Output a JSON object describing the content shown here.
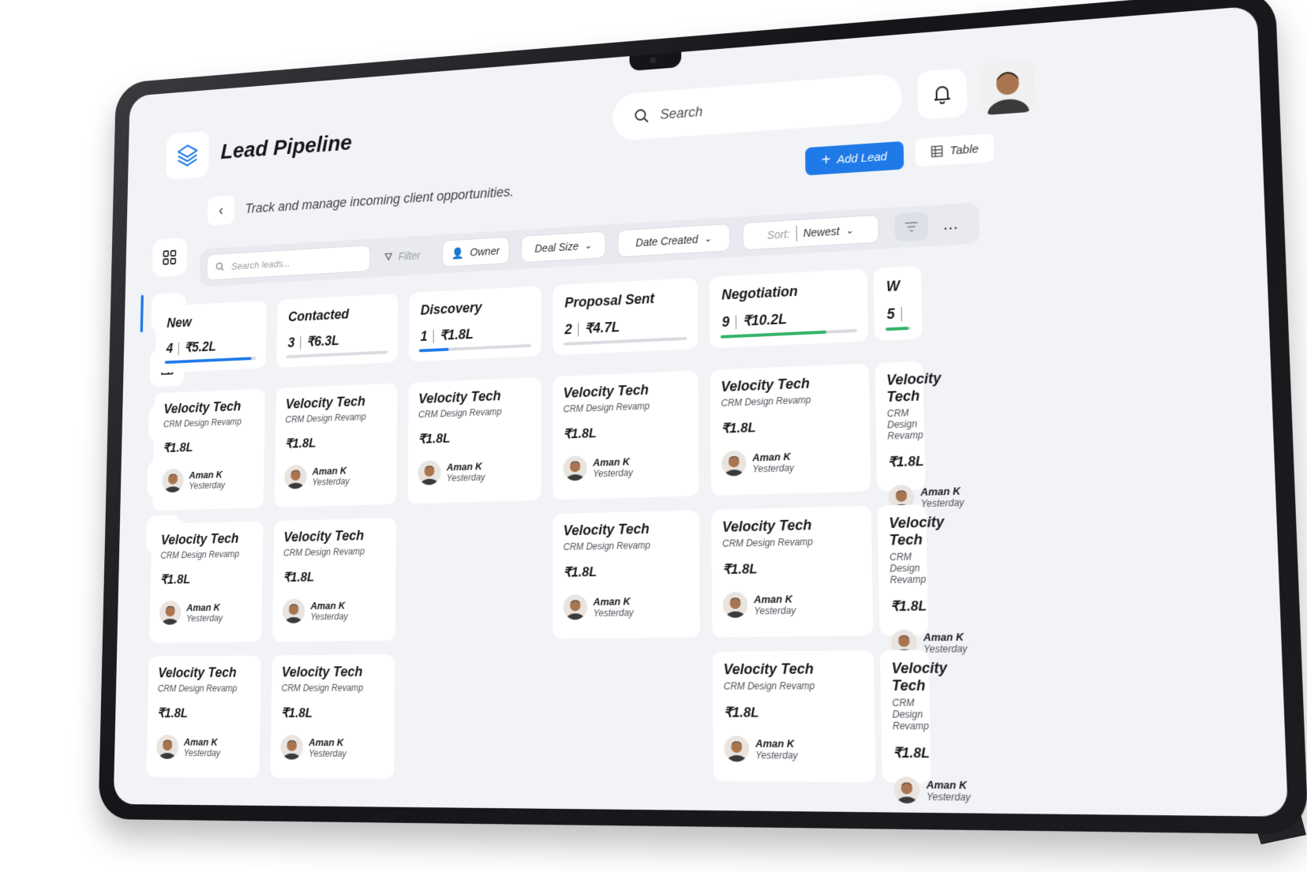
{
  "header": {
    "title": "Lead Pipeline",
    "subtitle": "Track and manage incoming client opportunities.",
    "search_placeholder": "Search",
    "add_lead_label": "Add Lead",
    "table_label": "Table"
  },
  "filters": {
    "search_placeholder": "Search leads...",
    "filter_label": "Filter",
    "owner_label": "Owner",
    "deal_size_label": "Deal Size",
    "date_created_label": "Date Created",
    "sort_prefix": "Sort:",
    "sort_value": "Newest",
    "more_label": "…"
  },
  "columns": [
    {
      "name": "New",
      "count": "4",
      "amount": "₹5.2L",
      "progress": 0.95,
      "color": "#1f7ae8"
    },
    {
      "name": "Contacted",
      "count": "3",
      "amount": "₹6.3L",
      "progress": 0.0,
      "color": "#1f7ae8"
    },
    {
      "name": "Discovery",
      "count": "1",
      "amount": "₹1.8L",
      "progress": 0.27,
      "color": "#1f7ae8"
    },
    {
      "name": "Proposal Sent",
      "count": "2",
      "amount": "₹4.7L",
      "progress": 0.0,
      "color": "#1f7ae8"
    },
    {
      "name": "Negotiation",
      "count": "9",
      "amount": "₹10.2L",
      "progress": 0.78,
      "color": "#34b36a"
    },
    {
      "name": "W",
      "count": "5",
      "amount": "",
      "progress": 0.9,
      "color": "#34b36a"
    }
  ],
  "card": {
    "company": "Velocity Tech",
    "project": "CRM Design Revamp",
    "amount": "₹1.8L",
    "owner": "Aman K",
    "date": "Yesterday"
  },
  "sidebar": {
    "items": [
      "dashboard-icon",
      "leads-icon",
      "companies-icon",
      "reports-icon",
      "tasks-icon",
      "analytics-icon"
    ],
    "active": 1
  },
  "colors": {
    "accent": "#1f7ae8",
    "success": "#34b36a",
    "background": "#f2f3f6"
  }
}
